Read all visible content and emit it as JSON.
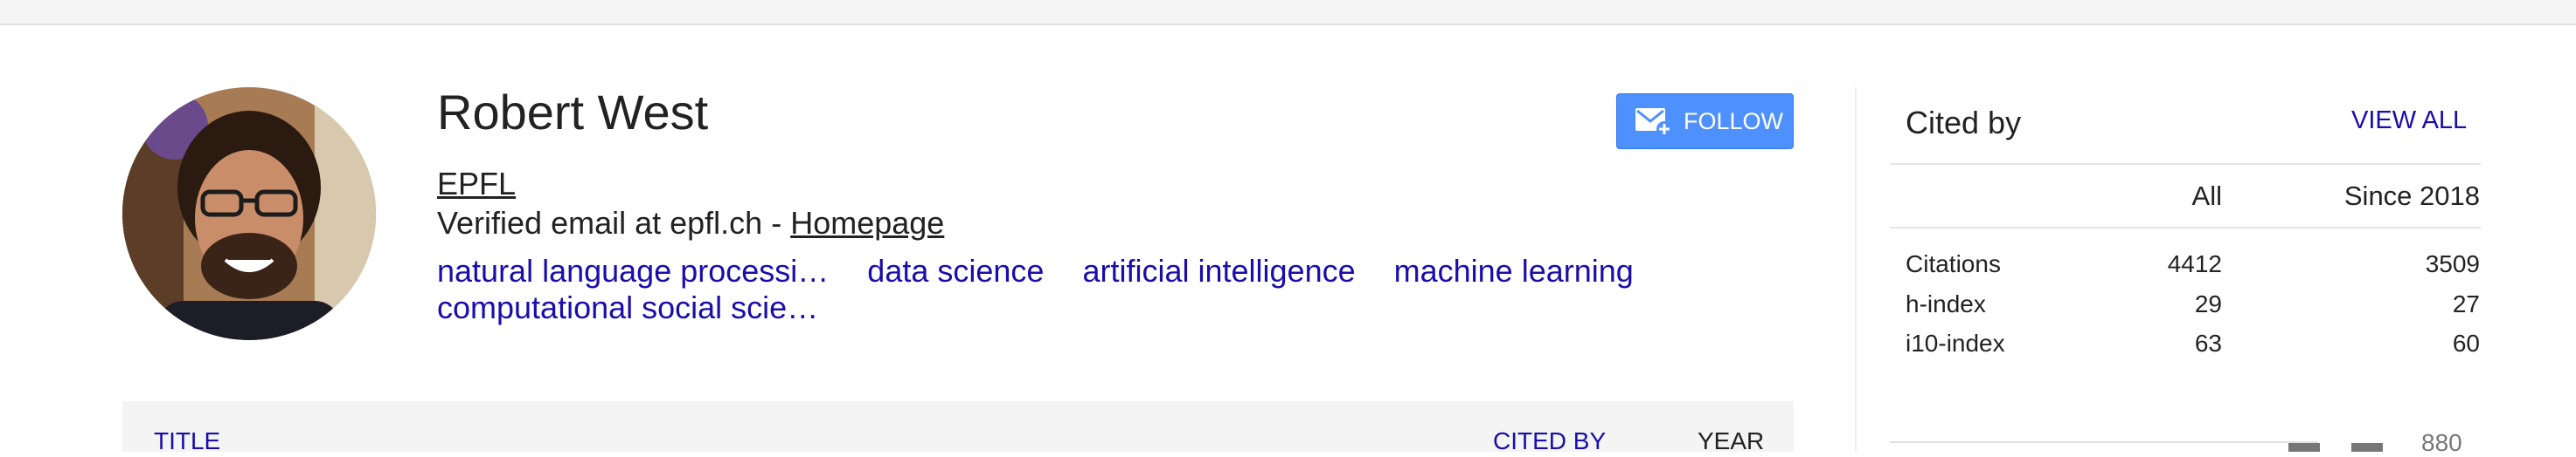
{
  "profile": {
    "name": "Robert West",
    "affiliation": "EPFL",
    "email_text": "Verified email at epfl.ch - ",
    "homepage_label": "Homepage",
    "interests": [
      "natural language processi…",
      "data science",
      "artificial intelligence",
      "machine learning",
      "computational social scie…"
    ]
  },
  "follow": {
    "label": "FOLLOW",
    "icon": "mail-plus-icon"
  },
  "table": {
    "title_col": "TITLE",
    "cited_col": "CITED BY",
    "year_col": "YEAR"
  },
  "cited_by": {
    "title": "Cited by",
    "view_all": "VIEW ALL",
    "columns": [
      "All",
      "Since 2018"
    ],
    "rows": [
      {
        "label": "Citations",
        "all": "4412",
        "since": "3509"
      },
      {
        "label": "h-index",
        "all": "29",
        "since": "27"
      },
      {
        "label": "i10-index",
        "all": "63",
        "since": "60"
      }
    ],
    "chart_axis_label": "880"
  },
  "colors": {
    "link": "#1a0dab",
    "button": "#4d90fe",
    "text": "#222222"
  }
}
